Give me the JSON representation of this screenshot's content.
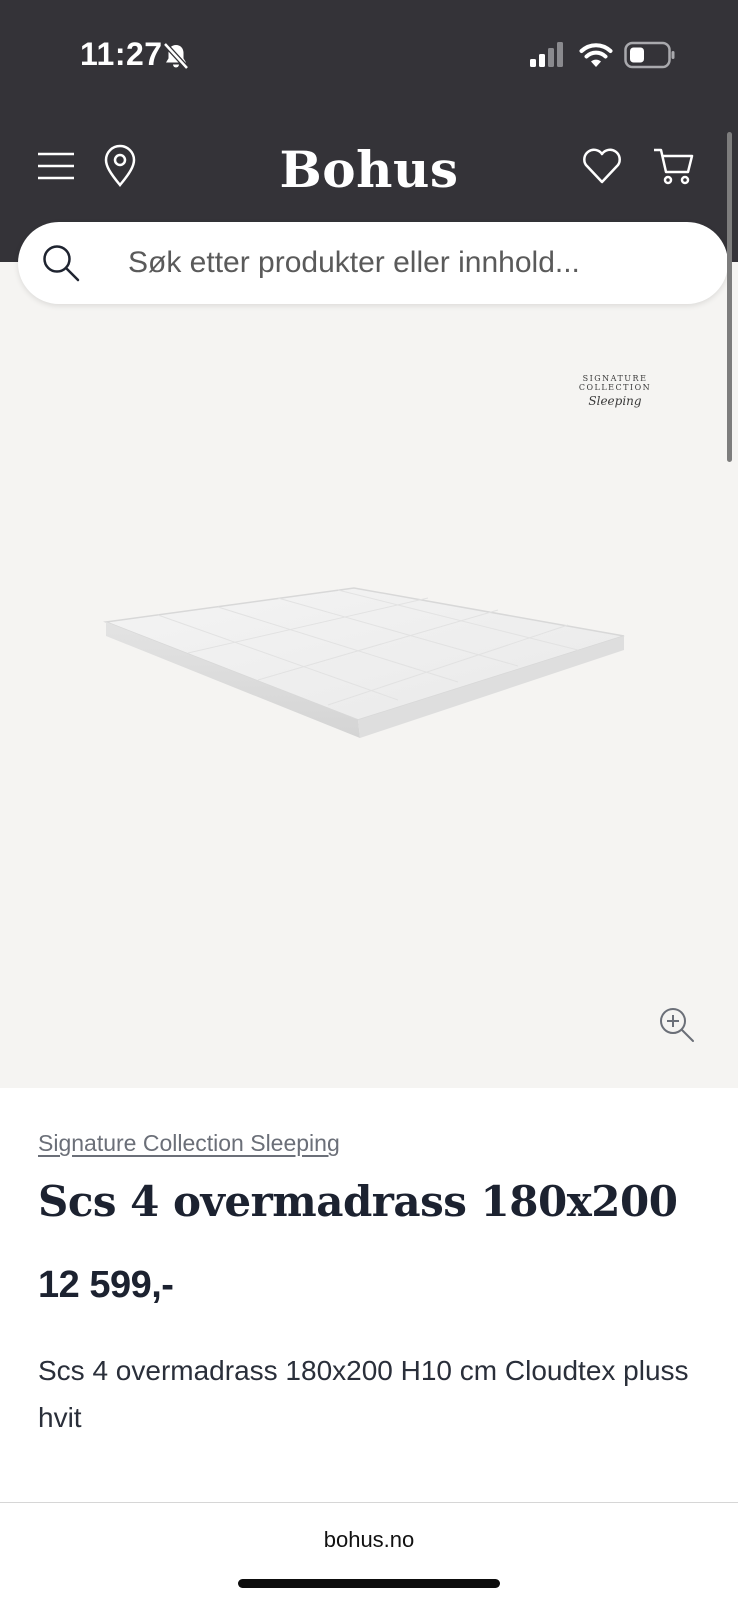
{
  "status_bar": {
    "time": "11:27",
    "icons": [
      "bell-slash-icon",
      "cellular-signal-icon",
      "wifi-icon",
      "battery-icon"
    ]
  },
  "header": {
    "brand": "Bohus",
    "icons": [
      "menu-icon",
      "location-pin-icon",
      "heart-icon",
      "cart-icon"
    ],
    "background_color": "#343338"
  },
  "search": {
    "placeholder": "Søk etter produkter eller innhold..."
  },
  "product_image": {
    "badge_line1": "SIGNATURE COLLECTION",
    "badge_line2": "Sleeping",
    "zoom_icon": "zoom-in-icon",
    "background_color": "#f5f4f2"
  },
  "product": {
    "brand_link": "Signature Collection Sleeping",
    "title": "Scs 4 overmadrass 180x200",
    "price": "12 599,-",
    "description": "Scs 4 overmadrass 180x200 H10 cm Cloudtex pluss hvit"
  },
  "browser": {
    "url": "bohus.no"
  }
}
